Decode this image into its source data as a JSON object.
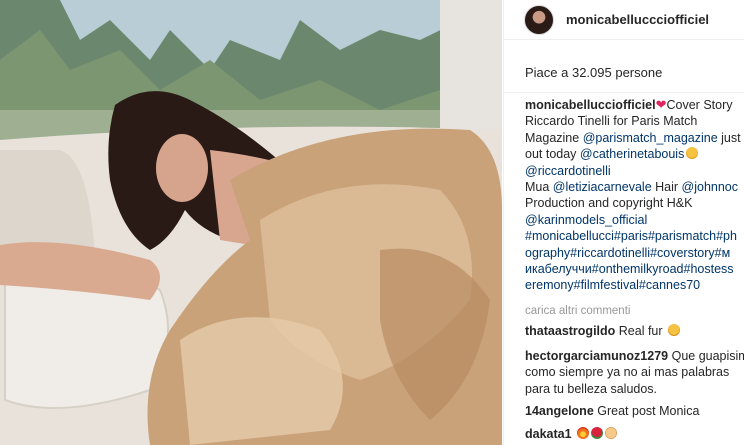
{
  "post": {
    "username": "monicabelluccciofficiel",
    "likes_text": "Piace a 32.095 persone",
    "caption": {
      "username": "monicabellucciofficiel",
      "heart": "❤",
      "line1": "Cover Story",
      "line2": "Riccardo Tinelli for Paris Match",
      "line3_text": "Magazine ",
      "line3_link": "@parismatch_magazine",
      "line3_tail": " just",
      "line4_text": "out today ",
      "line4_link": "@catherinetabouis",
      "line5_link": "@riccardotinelli",
      "line6_text": "Mua ",
      "line6_link": "@letiziacarnevale",
      "line6_mid": " Hair ",
      "line6_link2": "@johnnoc",
      "line7": "Production and copyright H&K",
      "line8_link": "@karinmodels_official",
      "line9": "#monicabellucci#paris#parismatch#ph",
      "line10": "ography#riccardotinelli#coverstory#м",
      "line11": "икабелуччи#onthemilkyroad#hostess",
      "line12": "eremony#filmfestival#cannes70"
    },
    "load_more": "carica altri commenti"
  },
  "comments": [
    {
      "username": "thataastrogildo",
      "text": "Real fur",
      "emoji": "sad-face"
    },
    {
      "username": "hectorgarciamunoz1279",
      "text": "Que guapisim",
      "line2": "como siempre ya no ai mas palabras",
      "line3": "para tu belleza saludos."
    },
    {
      "username": "14angelone",
      "text": "Great post Monica"
    },
    {
      "username": "dakata1",
      "text": "",
      "emoji": "fire-rose-hands"
    }
  ],
  "colors": {
    "link": "#003569",
    "text": "#262626",
    "muted": "#999999",
    "border": "#efefef",
    "heart": "#e0245e"
  }
}
